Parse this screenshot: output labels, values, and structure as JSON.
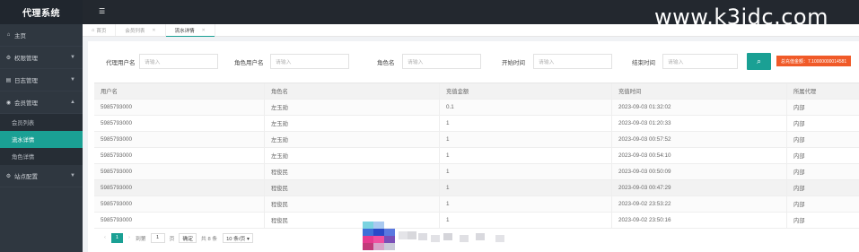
{
  "app": {
    "title": "代理系统",
    "watermark": "www.k3idc.com"
  },
  "sidebar": {
    "items": [
      {
        "label": "主页",
        "icon": "home-icon",
        "glyph": "⌂"
      },
      {
        "label": "权限管理",
        "icon": "gear-icon",
        "glyph": "⚙"
      },
      {
        "label": "日志管理",
        "icon": "log-icon",
        "glyph": "▤"
      },
      {
        "label": "会员管理",
        "icon": "user-icon",
        "glyph": "◉"
      }
    ],
    "sub_items": [
      {
        "label": "会员列表"
      },
      {
        "label": "流水详情"
      },
      {
        "label": "角色详情"
      }
    ],
    "last_item": {
      "label": "站点配置",
      "icon": "settings-icon",
      "glyph": "⚙"
    }
  },
  "tabs": [
    {
      "label": "首页",
      "icon": "home-icon"
    },
    {
      "label": "会员列表"
    },
    {
      "label": "流水详情"
    }
  ],
  "filters": {
    "agent_user": {
      "label": "代理用户名",
      "placeholder": "请输入"
    },
    "role_user": {
      "label": "角色用户名",
      "placeholder": "请输入"
    },
    "role_name": {
      "label": "角色名",
      "placeholder": "请输入"
    },
    "start_time": {
      "label": "开始时间",
      "placeholder": "请输入"
    },
    "end_time": {
      "label": "结束时间",
      "placeholder": "请输入"
    },
    "search_icon": "search-icon",
    "total_badge": "总充值金额：7.10000000014581"
  },
  "table": {
    "columns": [
      "用户名",
      "角色名",
      "充值金额",
      "充值时间",
      "所属代理"
    ],
    "rows": [
      [
        "5985793000",
        "左玉勋",
        "0.1",
        "2023-09-03 01:32:02",
        "内部"
      ],
      [
        "5985793000",
        "左玉勋",
        "1",
        "2023-09-03 01:20:33",
        "内部"
      ],
      [
        "5985793000",
        "左玉勋",
        "1",
        "2023-09-03 00:57:52",
        "内部"
      ],
      [
        "5985793000",
        "左玉勋",
        "1",
        "2023-09-03 00:54:10",
        "内部"
      ],
      [
        "5985793000",
        "程俊民",
        "1",
        "2023-09-03 00:50:09",
        "内部"
      ],
      [
        "5985793000",
        "程俊民",
        "1",
        "2023-09-03 00:47:29",
        "内部"
      ],
      [
        "5985793000",
        "程俊民",
        "1",
        "2023-09-02 23:53:22",
        "内部"
      ],
      [
        "5985793000",
        "程俊民",
        "1",
        "2023-09-02 23:50:16",
        "内部"
      ]
    ]
  },
  "pager": {
    "prev": "‹",
    "current": "1",
    "next": "›",
    "goto_label": "到第",
    "goto_value": "1",
    "page_unit": "页",
    "confirm": "确定",
    "total": "共 8 条",
    "per_page": "10 条/页 ▾"
  },
  "colors": {
    "accent": "#1aa094",
    "badge": "#f05a28",
    "sidebar": "#2f3740",
    "topbar": "#23282f"
  }
}
